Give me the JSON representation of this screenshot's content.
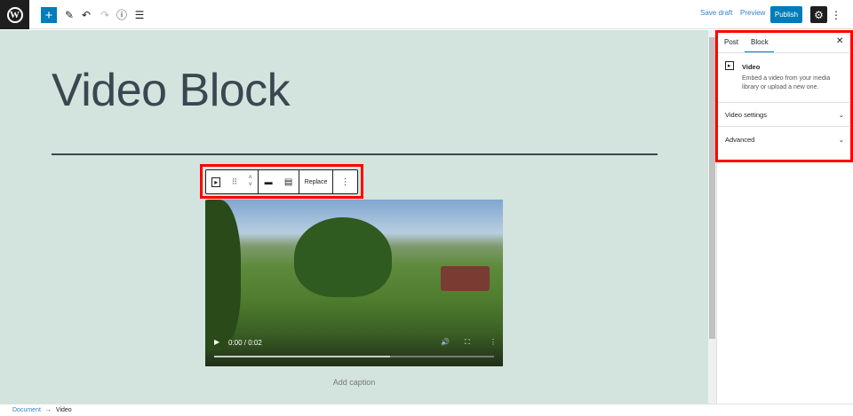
{
  "topbar": {
    "logo": "W",
    "add_icon": "plus-icon",
    "save_draft": "Save draft",
    "preview": "Preview",
    "publish": "Publish"
  },
  "editor": {
    "title": "Video Block",
    "caption_placeholder": "Add caption"
  },
  "block_toolbar": {
    "replace": "Replace"
  },
  "video": {
    "time": "0:00 / 0:02",
    "progress": 0.63
  },
  "sidebar": {
    "tabs": [
      "Post",
      "Block"
    ],
    "active_tab": "Block",
    "block_name": "Video",
    "block_desc_1": "Embed a video from your media",
    "block_desc_2": "library or upload a new one.",
    "sections": [
      "Video settings",
      "Advanced"
    ]
  },
  "breadcrumb": {
    "items": [
      "Document",
      "Video"
    ],
    "sep": "→"
  },
  "colors": {
    "accent": "#007cba",
    "highlight": "#ff0000",
    "canvas": "#d2e4dd"
  }
}
